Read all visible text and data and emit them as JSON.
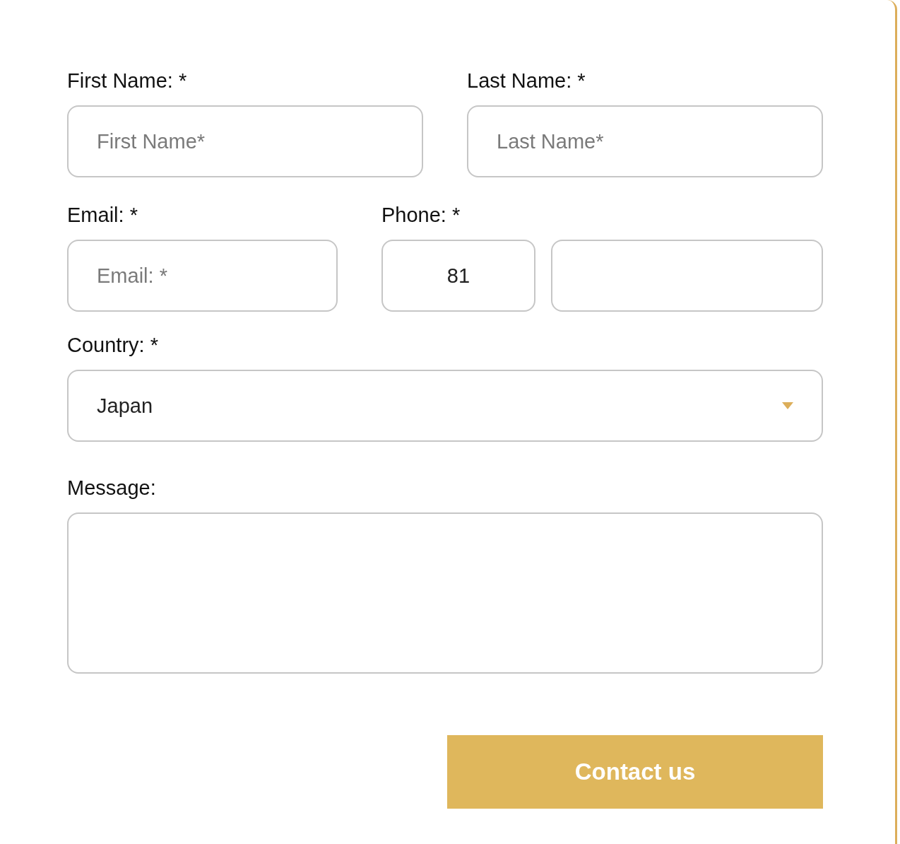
{
  "form": {
    "rows": [
      {
        "fields": [
          {
            "kind": "text",
            "label": "First Name: *",
            "placeholder": "First Name*"
          },
          {
            "kind": "text",
            "label": "Last Name: *",
            "placeholder": "Last Name*"
          }
        ]
      },
      {
        "fields": [
          {
            "kind": "text",
            "label": "Email: *",
            "placeholder": "Email: *"
          },
          {
            "kind": "phone",
            "label": "Phone: *",
            "code": "81"
          }
        ]
      },
      {
        "fields": [
          {
            "kind": "select",
            "label": "Country: *",
            "value": "Japan"
          }
        ]
      },
      {
        "fields": [
          {
            "kind": "textarea",
            "label": "Message:"
          }
        ]
      }
    ],
    "submit": "Contact us"
  }
}
